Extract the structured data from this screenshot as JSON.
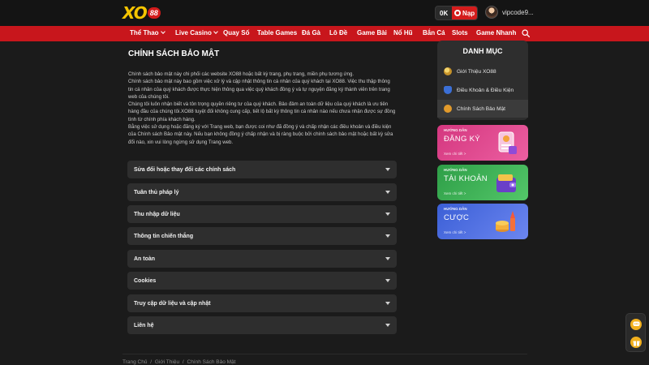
{
  "header": {
    "logo_text": "XO",
    "logo_badge": "88",
    "balance": "0K",
    "deposit_label": "Nạp",
    "username": "vipcode9..."
  },
  "nav": {
    "items": [
      {
        "label": "Thể Thao",
        "dropdown": true
      },
      {
        "label": "Live Casino",
        "dropdown": true
      },
      {
        "label": "Quay Số",
        "dropdown": false
      },
      {
        "label": "Table Games",
        "dropdown": false
      },
      {
        "label": "Đá Gà",
        "dropdown": false
      },
      {
        "label": "Lô Đề",
        "dropdown": false
      },
      {
        "label": "Game Bài",
        "dropdown": false
      },
      {
        "label": "Nổ Hũ",
        "dropdown": false
      },
      {
        "label": "Bắn Cá",
        "dropdown": false
      },
      {
        "label": "Slots",
        "dropdown": false
      },
      {
        "label": "Game Nhanh",
        "dropdown": false
      }
    ]
  },
  "main": {
    "title": "CHÍNH SÁCH BẢO MẬT",
    "paragraphs": [
      "Chính sách bảo mật này chi phối các website XO88 hoặc bất kỳ trang, phụ trang, miền phụ tương ứng.",
      "Chính sách bảo mật này bao gồm việc xử lý và cập nhật thông tin cá nhân của quý khách tại XO88. Việc thu thập thông tin cá nhân của quý khách được thực hiện thông qua việc quý khách đồng ý và tự nguyện đăng ký thành viên trên trang web của chúng tôi.",
      "Chúng tôi luôn nhận biết và tôn trọng quyền riêng tư của quý khách. Bảo đảm an toàn dữ liệu của quý khách là ưu tiên hàng đầu của chúng tôi.XO88 tuyệt đối không cung cấp, tiết lộ bất kỳ thông tin cá nhân nào nếu chưa nhận được sự đồng tình từ chính phía khách hàng.",
      "Bằng việc sử dụng hoặc đăng ký với Trang web, bạn được coi như đã đồng ý và chấp nhận các điều khoản và điều kiện của Chính sách Bảo mật này. Nếu bạn không đồng ý chấp nhận và bị ràng buộc bởi chính sách bảo mật hoặc bất kỳ sửa đổi nào, xin vui lòng ngừng sử dụng Trang web."
    ],
    "accordions": [
      "Sửa đổi hoặc thay đổi các chính sách",
      "Tuân thủ pháp lý",
      "Thu nhập dữ liệu",
      "Thông tin chiến thắng",
      "An toàn",
      "Cookies",
      "Truy cập dữ liệu và cập nhật",
      "Liên hệ"
    ]
  },
  "sidebar": {
    "menu_title": "DANH MỤC",
    "items": [
      {
        "label": "Giới Thiệu XO88",
        "icon": "gold-coin-icon",
        "color": "#5a6470"
      },
      {
        "label": "Điều Khoản & Điều Kiện",
        "icon": "shield-icon",
        "color": "#3b6fd6"
      },
      {
        "label": "Chính Sách Bảo Mật",
        "icon": "lock-icon",
        "color": "#e29a2b"
      }
    ],
    "promos": [
      {
        "small": "HƯỚNG DẪN",
        "big": "ĐĂNG KÝ",
        "link": "Xem chi tiết >",
        "from": "#d4377f",
        "to": "#ec5fa1"
      },
      {
        "small": "HƯỚNG DẪN",
        "big": "TÀI KHOẢN",
        "link": "Xem chi tiết >",
        "from": "#2e9e47",
        "to": "#53c769"
      },
      {
        "small": "HƯỚNG DẪN",
        "big": "CƯỢC",
        "link": "Xem chi tiết >",
        "from": "#3b5fd6",
        "to": "#6c86f0"
      }
    ]
  },
  "breadcrumb": {
    "items": [
      "Trang Chủ",
      "Giới Thiệu",
      "Chính Sách Bảo Mật"
    ],
    "separator": "/"
  },
  "colors": {
    "accent": "#c8161c",
    "logo": "#f5c400",
    "background": "#1b1b1b",
    "panel": "#2e2e2e"
  }
}
